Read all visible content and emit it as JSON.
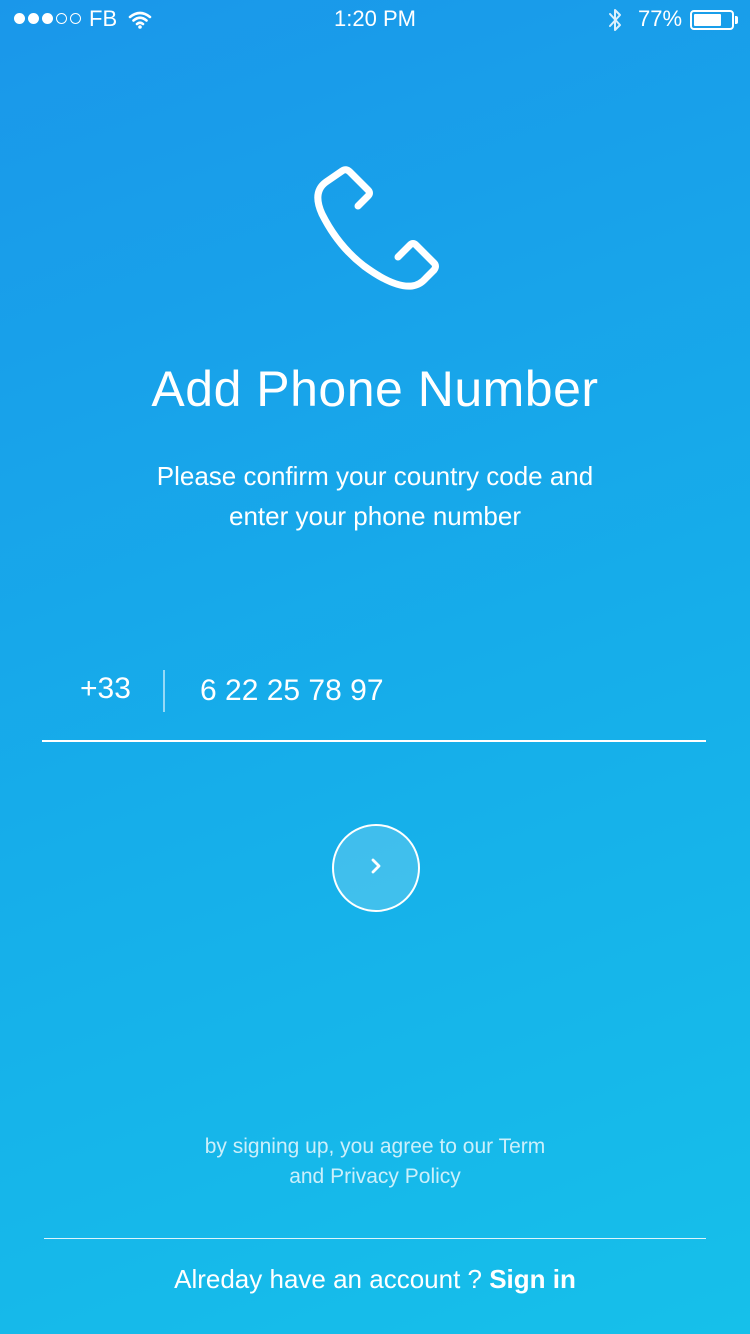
{
  "status_bar": {
    "signal_dots": [
      "on",
      "on",
      "on",
      "off",
      "off"
    ],
    "carrier": "FB",
    "time": "1:20 PM",
    "battery_percent": "77%",
    "battery_level": 0.77,
    "icons": [
      "wifi-icon",
      "bluetooth-icon",
      "battery-icon"
    ]
  },
  "header": {
    "icon": "phone-icon",
    "title": "Add Phone Number",
    "subtitle_lines": [
      "Please confirm your country code and",
      "enter your phone number"
    ]
  },
  "form": {
    "country_code": "+33",
    "phone_value": "6 22 25 78 97",
    "next_icon": "chevron-right-icon"
  },
  "footer": {
    "terms_lines": [
      "by signing up, you agree to our Term",
      "and Privacy Policy"
    ],
    "account_prompt": "Alreday have an account ? ",
    "signin_label": "Sign in"
  },
  "colors": {
    "background_top": "#1a97ea",
    "background_bottom": "#16c0ea",
    "foreground": "#ffffff"
  }
}
